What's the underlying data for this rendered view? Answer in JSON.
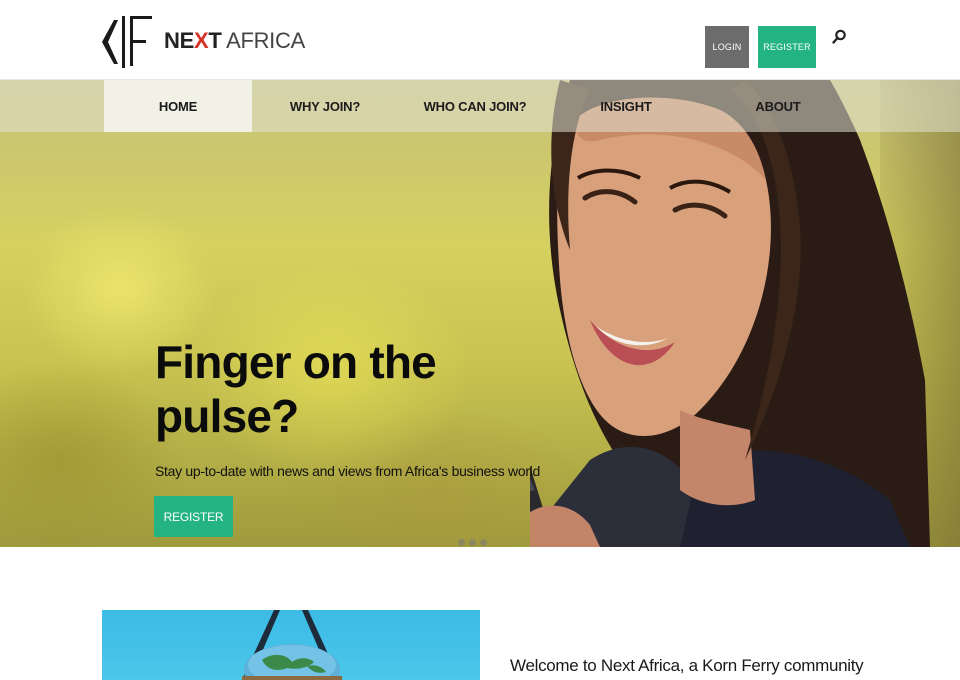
{
  "brand": {
    "name_part1": "NE",
    "name_x": "X",
    "name_part2": "T",
    "name_part3": " AFRICA",
    "accent": "#d93025"
  },
  "header": {
    "login_label": "LOGIN",
    "register_label": "REGISTER",
    "search_icon": "search-icon",
    "colors": {
      "login_bg": "#6c6c6c",
      "register_bg": "#24b383"
    }
  },
  "nav": {
    "items": [
      {
        "label": "HOME",
        "active": true
      },
      {
        "label": "WHY JOIN?",
        "active": false
      },
      {
        "label": "WHO CAN JOIN?",
        "active": false
      },
      {
        "label": "INSIGHT",
        "active": false
      },
      {
        "label": "ABOUT",
        "active": false
      }
    ]
  },
  "hero": {
    "title": "Finger on the pulse?",
    "subtitle": "Stay up-to-date with news and views from Africa's business world",
    "register_label": "REGISTER",
    "slide_count": 3
  },
  "intro": {
    "welcome_text": "Welcome to Next Africa, a Korn Ferry community"
  }
}
